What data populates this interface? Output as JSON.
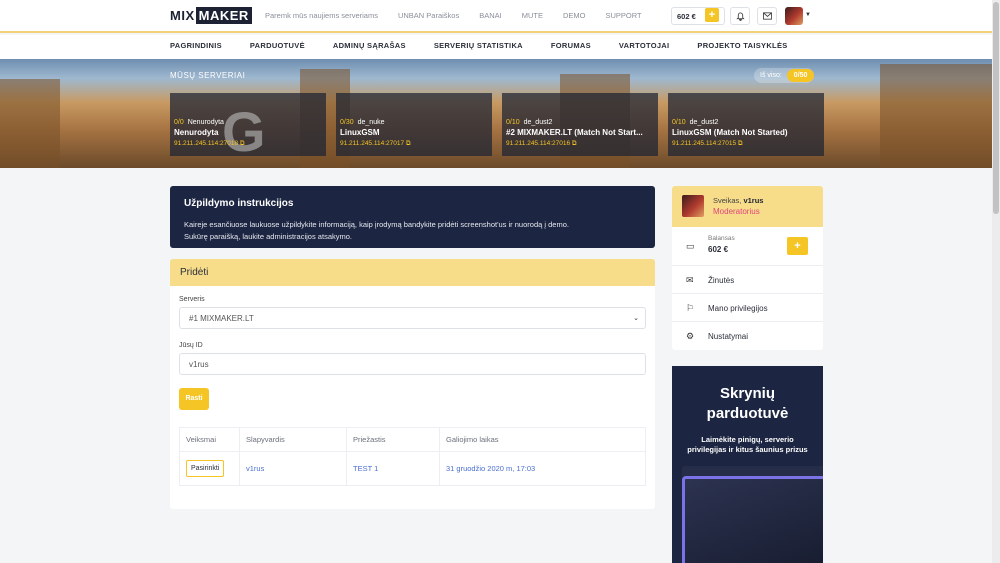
{
  "header": {
    "logo_mix": "MIX",
    "logo_maker": "MAKER",
    "links": [
      "Paremk mūs naujiems serveriams",
      "UNBAN Paraiškos",
      "BANAI",
      "MUTE",
      "DEMO",
      "SUPPORT"
    ],
    "balance": "602 €",
    "plus": "+"
  },
  "nav": [
    "PAGRINDINIS",
    "PARDUOTUVĖ",
    "ADMINŲ SĄRAŠAS",
    "SERVERIŲ STATISTIKA",
    "FORUMAS",
    "VARTOTOJAI",
    "PROJEKTO TAISYKLĖS"
  ],
  "hero": {
    "title": "MŪSŲ SERVERIAI",
    "total_label": "Iš viso:",
    "total_value": "0/50",
    "servers": [
      {
        "players": "0/0",
        "map": "Nenurodyta",
        "name": "Nenurodyta",
        "ip": "91.211.245.114:27018 ⧉"
      },
      {
        "players": "0/30",
        "map": "de_nuke",
        "name": "LinuxGSM",
        "ip": "91.211.245.114:27017 ⧉"
      },
      {
        "players": "0/10",
        "map": "de_dust2",
        "name": "#2 MIXMAKER.LT (Match Not Start...",
        "ip": "91.211.245.114:27016 ⧉"
      },
      {
        "players": "0/10",
        "map": "de_dust2",
        "name": "LinuxGSM (Match Not Started)",
        "ip": "91.211.245.114:27015 ⧉"
      }
    ]
  },
  "instructions": {
    "title": "Užpildymo instrukcijos",
    "line1": "Kaireje esančiuose laukuose užpildykite informaciją, kaip įrodymą bandykite pridėti screenshot'us ir nuorodą į demo.",
    "line2": "Sukūrę paraišką, laukite administracijos atsakymo."
  },
  "form": {
    "header": "Pridėti",
    "server_label": "Serveris",
    "server_value": "#1 MIXMAKER.LT",
    "id_label": "Jūsų ID",
    "id_value": "v1rus",
    "find_button": "Rasti",
    "columns": [
      "Veiksmai",
      "Slapyvardis",
      "Priežastis",
      "Galiojimo laikas"
    ],
    "row": {
      "action": "Pasirinkti",
      "nick": "v1rus",
      "reason": "TEST 1",
      "expires": "31 gruodžio 2020 m, 17:03"
    }
  },
  "user": {
    "greeting": "Sveikas,",
    "name": "v1rus",
    "role": "Moderatorius",
    "balance_label": "Balansas",
    "balance_value": "602 €",
    "messages": "Žinutės",
    "privileges": "Mano privilegijos",
    "settings": "Nustatymai"
  },
  "promo": {
    "title_line1": "Skrynių",
    "title_line2": "parduotuvė",
    "text_line1": "Laimėkite pinigų, serverio",
    "text_line2": "privilegijas ir kitus šaunius prizus"
  }
}
